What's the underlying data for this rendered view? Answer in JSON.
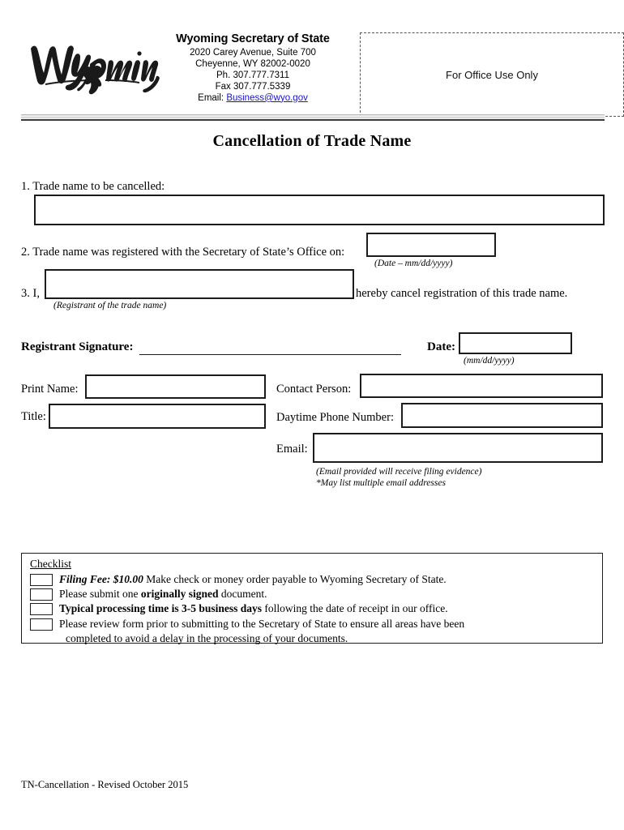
{
  "header": {
    "agency_name": "Wyoming Secretary of State",
    "address_line1": "2020 Carey Avenue, Suite 700",
    "address_line2": "Cheyenne, WY 82002-0020",
    "phone": "Ph.  307.777.7311",
    "fax": "Fax 307.777.5339",
    "email_label": "Email:",
    "email_address": "Business@wyo.gov",
    "email_link_color": "#1a12c8",
    "logo_text": "Wyoming",
    "office_use_box": "For Office Use Only"
  },
  "title": "Cancellation of Trade Name",
  "items": {
    "item1_label": "1. Trade name to be cancelled:",
    "item2_label": "2. Trade name was registered with the Secretary of State’s Office on:",
    "item2_caption": "(Date – mm/dd/yyyy)",
    "item3_prefix": "3. I,",
    "item3_caption": "(Registrant of the trade name)",
    "item3_suffix": "hereby cancel registration of this trade name."
  },
  "signature": {
    "label": "Registrant Signature:",
    "date_label": "Date:",
    "date_caption": "(mm/dd/yyyy)"
  },
  "contact": {
    "print_name_label": "Print Name:",
    "title_label": "Title:",
    "contact_person_label": "Contact Person:",
    "phone_label": "Daytime Phone Number:",
    "email_label": "Email:",
    "email_note1": "(Email provided will receive filing evidence)",
    "email_note2": "*May list multiple email addresses"
  },
  "checklist": {
    "heading": "Checklist",
    "rows": [
      {
        "segments": [
          {
            "text": "Filing Fee: $10.00",
            "style": "bold-italic"
          },
          {
            "text": "   Make check or money order payable to Wyoming Secretary of State.",
            "style": "normal"
          }
        ]
      },
      {
        "segments": [
          {
            "text": "Please submit one ",
            "style": "normal"
          },
          {
            "text": "originally signed",
            "style": "bold"
          },
          {
            "text": " document.",
            "style": "normal"
          }
        ]
      },
      {
        "segments": [
          {
            "text": "Typical processing time is 3-5 business days",
            "style": "bold"
          },
          {
            "text": " following the date of receipt in our office.",
            "style": "normal"
          }
        ]
      },
      {
        "segments": [
          {
            "text": "Please review form prior to submitting to the Secretary of State to ensure all areas have been",
            "style": "normal"
          },
          {
            "text": "completed to avoid a delay in the processing of your documents.",
            "style": "continuation"
          }
        ]
      }
    ]
  },
  "footer": "TN-Cancellation - Revised October 2015"
}
